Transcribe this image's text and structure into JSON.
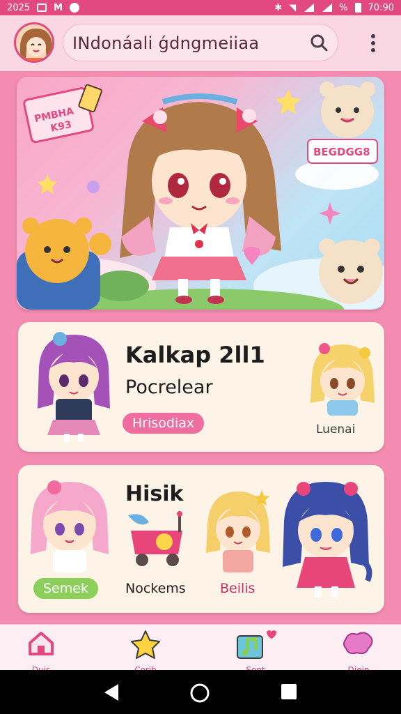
{
  "status_bar": {
    "time_left": "2025",
    "time_right": "70:90",
    "battery_label": "%"
  },
  "header": {
    "search_text": "INdonáali ǵdngmeiiaa"
  },
  "hero": {
    "badge_text": "PMBHA\nK93",
    "badge_right": "BEGDGG8"
  },
  "card1": {
    "title": "Kalkap 2ll1",
    "subtitle": "Pocrelear",
    "pill": "Hrisodiax",
    "right_label": "Luenai"
  },
  "card2": {
    "title": "Hisik",
    "pill": "Semek",
    "label_1": "Nockems",
    "label_2": "Beilis"
  },
  "bottom_nav": {
    "items": [
      {
        "label": "Duis"
      },
      {
        "label": "Corib"
      },
      {
        "label": "Sont"
      },
      {
        "label": "Diein"
      }
    ]
  },
  "colors": {
    "accent": "#e24a7f",
    "background": "#f48bb1",
    "card": "#fdf3e6"
  }
}
